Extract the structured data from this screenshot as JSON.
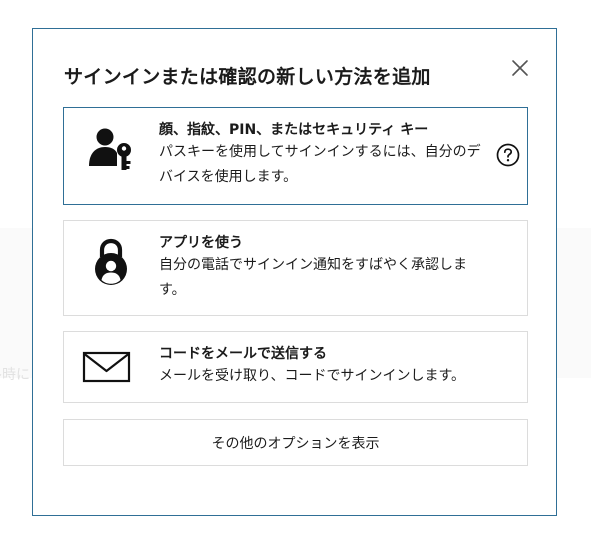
{
  "background": {
    "fragment_text": "ル時に"
  },
  "dialog": {
    "title": "サインインまたは確認の新しい方法を追加",
    "close_icon": "close-icon",
    "options": [
      {
        "title": "顔、指紋、PIN、またはセキュリティ キー",
        "description": "パスキーを使用してサインインするには、自分のデバイスを使用します。",
        "icon": "user-key-icon",
        "help_icon": "question-circle-icon",
        "selected": true
      },
      {
        "title": "アプリを使う",
        "description": "自分の電話でサインイン通知をすばやく承認します。",
        "icon": "authenticator-lock-icon",
        "selected": false
      },
      {
        "title": "コードをメールで送信する",
        "description": "メールを受け取り、コードでサインインします。",
        "icon": "envelope-icon",
        "selected": false
      }
    ],
    "more_options_label": "その他のオプションを表示"
  },
  "colors": {
    "dialog_border": "#2f6f96",
    "card_border": "#dcdcdc",
    "text": "#1b1b1b"
  }
}
